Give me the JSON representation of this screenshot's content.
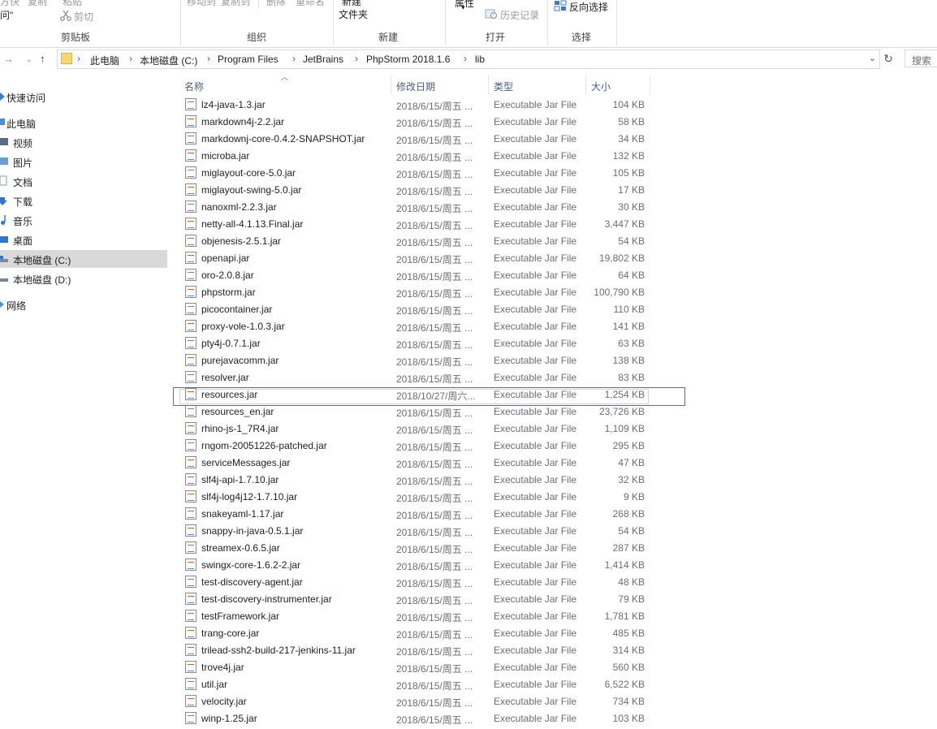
{
  "ribbon": {
    "top_left": [
      "方快",
      "复制",
      "粘贴"
    ],
    "left_fragment": "问\"",
    "cut": "剪切",
    "clipboard_group": "剪贴板",
    "organize_partial": [
      "移动到",
      "复制到"
    ],
    "delete_partial": "删除",
    "rename_partial": "重命名",
    "organize_group": "组织",
    "new_partial": "新建",
    "new_folder": "文件夹",
    "new_group": "新建",
    "properties": "属性",
    "history": "历史记录",
    "open_group": "打开",
    "invert_select": "反向选择",
    "select_group": "选择"
  },
  "address": {
    "crumbs": [
      "此电脑",
      "本地磁盘 (C:)",
      "Program Files",
      "JetBrains",
      "PhpStorm 2018.1.6",
      "lib"
    ]
  },
  "search": {
    "placeholder": "搜索"
  },
  "sidebar": {
    "items": [
      {
        "label": "快速访问",
        "icon": "star-icon",
        "selected": false
      },
      {
        "label": "此电脑",
        "icon": "computer-icon",
        "selected": false
      },
      {
        "label": "视频",
        "icon": "video-icon",
        "selected": false
      },
      {
        "label": "图片",
        "icon": "picture-icon",
        "selected": false
      },
      {
        "label": "文档",
        "icon": "document-icon",
        "selected": false
      },
      {
        "label": "下载",
        "icon": "download-icon",
        "selected": false
      },
      {
        "label": "音乐",
        "icon": "music-icon",
        "selected": false
      },
      {
        "label": "桌面",
        "icon": "desktop-icon",
        "selected": false
      },
      {
        "label": "本地磁盘 (C:)",
        "icon": "drive-icon",
        "selected": true
      },
      {
        "label": "本地磁盘 (D:)",
        "icon": "drive-icon",
        "selected": false
      },
      {
        "label": "网络",
        "icon": "network-icon",
        "selected": false
      }
    ]
  },
  "columns": {
    "name": "名称",
    "date": "修改日期",
    "type": "类型",
    "size": "大小"
  },
  "highlight_color": "#e0393c",
  "files": [
    {
      "name": "lz4-java-1.3.jar",
      "date": "2018/6/15/周五 ...",
      "type": "Executable Jar File",
      "size": "104 KB"
    },
    {
      "name": "markdown4j-2.2.jar",
      "date": "2018/6/15/周五 ...",
      "type": "Executable Jar File",
      "size": "58 KB"
    },
    {
      "name": "markdownj-core-0.4.2-SNAPSHOT.jar",
      "date": "2018/6/15/周五 ...",
      "type": "Executable Jar File",
      "size": "34 KB"
    },
    {
      "name": "microba.jar",
      "date": "2018/6/15/周五 ...",
      "type": "Executable Jar File",
      "size": "132 KB"
    },
    {
      "name": "miglayout-core-5.0.jar",
      "date": "2018/6/15/周五 ...",
      "type": "Executable Jar File",
      "size": "105 KB"
    },
    {
      "name": "miglayout-swing-5.0.jar",
      "date": "2018/6/15/周五 ...",
      "type": "Executable Jar File",
      "size": "17 KB"
    },
    {
      "name": "nanoxml-2.2.3.jar",
      "date": "2018/6/15/周五 ...",
      "type": "Executable Jar File",
      "size": "30 KB"
    },
    {
      "name": "netty-all-4.1.13.Final.jar",
      "date": "2018/6/15/周五 ...",
      "type": "Executable Jar File",
      "size": "3,447 KB"
    },
    {
      "name": "objenesis-2.5.1.jar",
      "date": "2018/6/15/周五 ...",
      "type": "Executable Jar File",
      "size": "54 KB"
    },
    {
      "name": "openapi.jar",
      "date": "2018/6/15/周五 ...",
      "type": "Executable Jar File",
      "size": "19,802 KB"
    },
    {
      "name": "oro-2.0.8.jar",
      "date": "2018/6/15/周五 ...",
      "type": "Executable Jar File",
      "size": "64 KB"
    },
    {
      "name": "phpstorm.jar",
      "date": "2018/6/15/周五 ...",
      "type": "Executable Jar File",
      "size": "100,790 KB"
    },
    {
      "name": "picocontainer.jar",
      "date": "2018/6/15/周五 ...",
      "type": "Executable Jar File",
      "size": "110 KB"
    },
    {
      "name": "proxy-vole-1.0.3.jar",
      "date": "2018/6/15/周五 ...",
      "type": "Executable Jar File",
      "size": "141 KB"
    },
    {
      "name": "pty4j-0.7.1.jar",
      "date": "2018/6/15/周五 ...",
      "type": "Executable Jar File",
      "size": "63 KB"
    },
    {
      "name": "purejavacomm.jar",
      "date": "2018/6/15/周五 ...",
      "type": "Executable Jar File",
      "size": "138 KB"
    },
    {
      "name": "resolver.jar",
      "date": "2018/6/15/周五 ...",
      "type": "Executable Jar File",
      "size": "83 KB"
    },
    {
      "name": "resources.jar",
      "date": "2018/10/27/周六...",
      "type": "Executable Jar File",
      "size": "1,254 KB"
    },
    {
      "name": "resources_en.jar",
      "date": "2018/6/15/周五 ...",
      "type": "Executable Jar File",
      "size": "23,726 KB"
    },
    {
      "name": "rhino-js-1_7R4.jar",
      "date": "2018/6/15/周五 ...",
      "type": "Executable Jar File",
      "size": "1,109 KB"
    },
    {
      "name": "rngom-20051226-patched.jar",
      "date": "2018/6/15/周五 ...",
      "type": "Executable Jar File",
      "size": "295 KB"
    },
    {
      "name": "serviceMessages.jar",
      "date": "2018/6/15/周五 ...",
      "type": "Executable Jar File",
      "size": "47 KB"
    },
    {
      "name": "slf4j-api-1.7.10.jar",
      "date": "2018/6/15/周五 ...",
      "type": "Executable Jar File",
      "size": "32 KB"
    },
    {
      "name": "slf4j-log4j12-1.7.10.jar",
      "date": "2018/6/15/周五 ...",
      "type": "Executable Jar File",
      "size": "9 KB"
    },
    {
      "name": "snakeyaml-1.17.jar",
      "date": "2018/6/15/周五 ...",
      "type": "Executable Jar File",
      "size": "268 KB"
    },
    {
      "name": "snappy-in-java-0.5.1.jar",
      "date": "2018/6/15/周五 ...",
      "type": "Executable Jar File",
      "size": "54 KB"
    },
    {
      "name": "streamex-0.6.5.jar",
      "date": "2018/6/15/周五 ...",
      "type": "Executable Jar File",
      "size": "287 KB"
    },
    {
      "name": "swingx-core-1.6.2-2.jar",
      "date": "2018/6/15/周五 ...",
      "type": "Executable Jar File",
      "size": "1,414 KB"
    },
    {
      "name": "test-discovery-agent.jar",
      "date": "2018/6/15/周五 ...",
      "type": "Executable Jar File",
      "size": "48 KB"
    },
    {
      "name": "test-discovery-instrumenter.jar",
      "date": "2018/6/15/周五 ...",
      "type": "Executable Jar File",
      "size": "79 KB"
    },
    {
      "name": "testFramework.jar",
      "date": "2018/6/15/周五 ...",
      "type": "Executable Jar File",
      "size": "1,781 KB"
    },
    {
      "name": "trang-core.jar",
      "date": "2018/6/15/周五 ...",
      "type": "Executable Jar File",
      "size": "485 KB"
    },
    {
      "name": "trilead-ssh2-build-217-jenkins-11.jar",
      "date": "2018/6/15/周五 ...",
      "type": "Executable Jar File",
      "size": "314 KB"
    },
    {
      "name": "trove4j.jar",
      "date": "2018/6/15/周五 ...",
      "type": "Executable Jar File",
      "size": "560 KB"
    },
    {
      "name": "util.jar",
      "date": "2018/6/15/周五 ...",
      "type": "Executable Jar File",
      "size": "6,522 KB"
    },
    {
      "name": "velocity.jar",
      "date": "2018/6/15/周五 ...",
      "type": "Executable Jar File",
      "size": "734 KB"
    },
    {
      "name": "winp-1.25.jar",
      "date": "2018/6/15/周五 ...",
      "type": "Executable Jar File",
      "size": "103 KB"
    }
  ]
}
